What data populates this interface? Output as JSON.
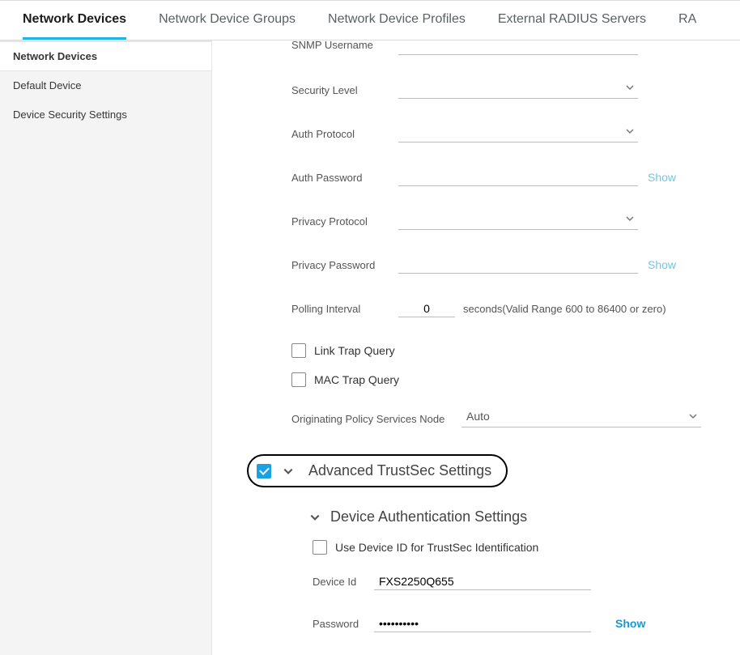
{
  "tabs": {
    "t1": "Network Devices",
    "t2": "Network Device Groups",
    "t3": "Network Device Profiles",
    "t4": "External RADIUS Servers",
    "t5": "RA"
  },
  "sidebar": {
    "s1": "Network Devices",
    "s2": "Default Device",
    "s3": "Device Security Settings"
  },
  "snmp": {
    "username_label": "SNMP Username",
    "seclevel_label": "Security Level",
    "authproto_label": "Auth Protocol",
    "authpass_label": "Auth Password",
    "privproto_label": "Privacy Protocol",
    "privpass_label": "Privacy Password",
    "polling_label": "Polling Interval",
    "polling_value": "0",
    "polling_hint": "seconds(Valid Range 600 to 86400 or zero)",
    "link_trap": "Link Trap Query",
    "mac_trap": "MAC Trap Query",
    "orig_label": "Originating Policy Services Node",
    "orig_value": "Auto",
    "show": "Show"
  },
  "trustsec": {
    "header": "Advanced TrustSec Settings",
    "sub_header": "Device Authentication Settings",
    "use_device_id": "Use Device ID for TrustSec Identification",
    "device_id_label": "Device Id",
    "device_id_value": "FXS2250Q655",
    "password_label": "Password",
    "password_value": "••••••••••",
    "show": "Show"
  }
}
